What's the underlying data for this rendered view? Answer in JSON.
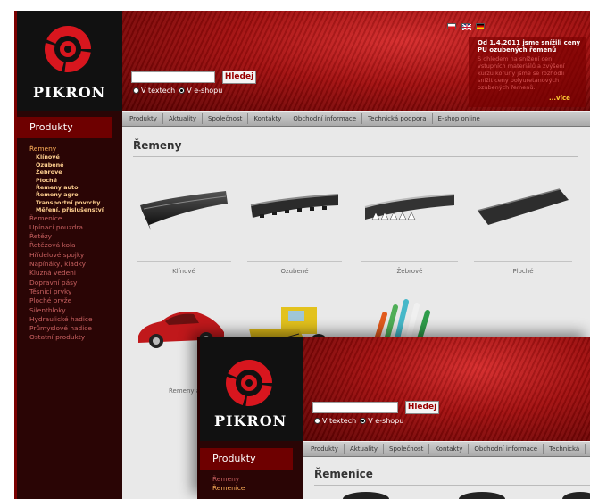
{
  "brand": {
    "name": "PIKRON"
  },
  "search": {
    "button_label": "Hledej",
    "option_texts": "V textech",
    "option_eshop": "V e-shopu",
    "selected_option": "V e-shopu"
  },
  "news": {
    "headline": "Od 1.4.2011 jsme snížili ceny PU ozubených řemenů",
    "body": "S ohledem na snížení cen vstupních materiálů a zvýšení kurzu koruny jsme se rozhodli snížit ceny polyuretanových ozubených řemenů.",
    "more_label": "...více"
  },
  "nav": {
    "items": [
      "Produkty",
      "Aktuality",
      "Společnost",
      "Kontakty",
      "Obchodní informace",
      "Technická podpora",
      "E-shop online"
    ]
  },
  "sidebar": {
    "heading": "Produkty",
    "items": [
      {
        "label": "Řemeny",
        "level": "selected"
      },
      {
        "label": "Klínové",
        "level": "sub"
      },
      {
        "label": "Ozubené",
        "level": "sub"
      },
      {
        "label": "Žebrové",
        "level": "sub"
      },
      {
        "label": "Ploché",
        "level": "sub"
      },
      {
        "label": "Řemeny auto",
        "level": "sub"
      },
      {
        "label": "Řemeny agro",
        "level": "sub"
      },
      {
        "label": "Transportní povrchy",
        "level": "sub"
      },
      {
        "label": "Měření, příslušenství",
        "level": "sub"
      },
      {
        "label": "Řemenice",
        "level": "top"
      },
      {
        "label": "Upínací pouzdra",
        "level": "top"
      },
      {
        "label": "Řetězy",
        "level": "top"
      },
      {
        "label": "Řetězová kola",
        "level": "top"
      },
      {
        "label": "Hřídelové spojky",
        "level": "top"
      },
      {
        "label": "Napínáky, kladky",
        "level": "top"
      },
      {
        "label": "Kluzná vedení",
        "level": "top"
      },
      {
        "label": "Dopravní pásy",
        "level": "top"
      },
      {
        "label": "Těsnicí prvky",
        "level": "top"
      },
      {
        "label": "Ploché pryže",
        "level": "top"
      },
      {
        "label": "Silentbloky",
        "level": "top"
      },
      {
        "label": "Hydraulické hadice",
        "level": "top"
      },
      {
        "label": "Průmyslové hadice",
        "level": "top"
      },
      {
        "label": "Ostatní produkty",
        "level": "top"
      }
    ]
  },
  "main": {
    "title": "Řemeny",
    "products": [
      {
        "label": "Klínové"
      },
      {
        "label": "Ozubené"
      },
      {
        "label": "Žebrové"
      },
      {
        "label": "Ploché"
      }
    ],
    "row2_label": "Řemeny au"
  },
  "window2": {
    "brand": "PIKRON",
    "search_button": "Hledej",
    "option_texts": "V textech",
    "option_eshop": "V e-shopu",
    "nav_items": [
      "Produkty",
      "Aktuality",
      "Společnost",
      "Kontakty",
      "Obchodní informace",
      "Technická"
    ],
    "sidebar_heading": "Produkty",
    "sidebar_items": [
      {
        "label": "Řemeny",
        "level": "top"
      },
      {
        "label": "Řemenice",
        "level": "selected"
      }
    ],
    "title": "Řemenice"
  },
  "colors": {
    "brand_red": "#b3121a",
    "sidebar_dark": "#2a0505",
    "selected_orange": "#ffb15a"
  },
  "icons": [
    "pikron-logo-icon",
    "flag-cz-icon",
    "flag-uk-icon",
    "flag-de-icon"
  ]
}
